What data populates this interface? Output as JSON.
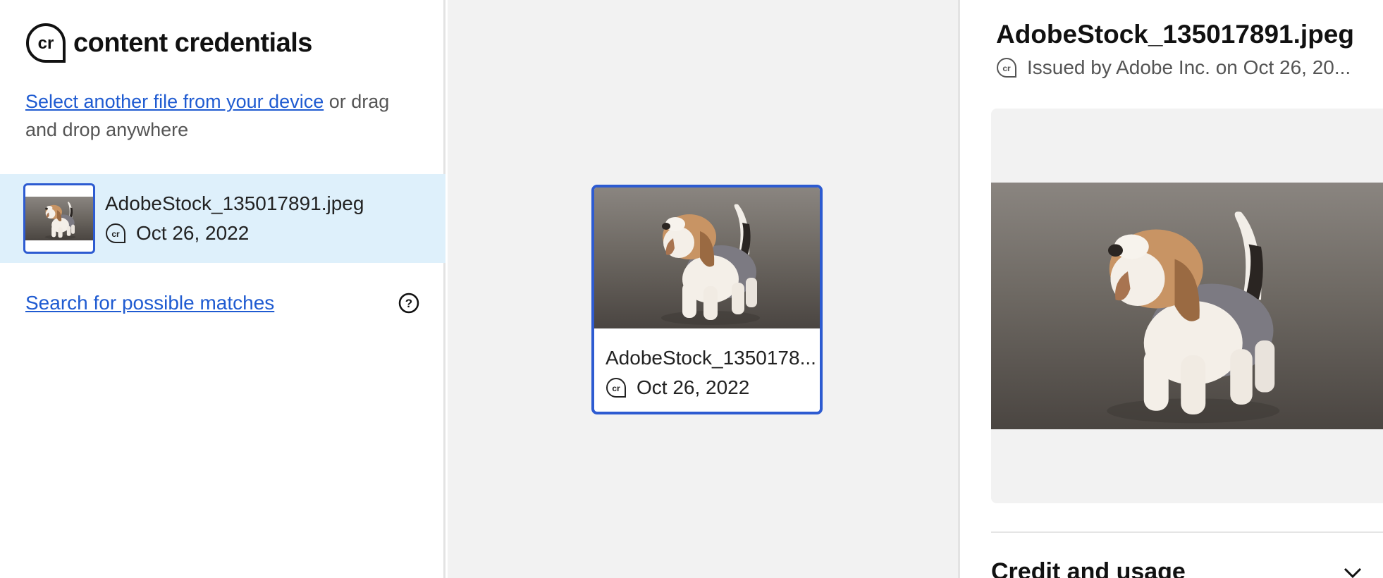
{
  "brand": {
    "logo_text": "cr",
    "name": "content credentials"
  },
  "intro": {
    "link": "Select another file from your device",
    "rest": " or drag and drop anywhere"
  },
  "file_list": [
    {
      "name": "AdobeStock_135017891.jpeg",
      "date": "Oct 26, 2022"
    }
  ],
  "search": {
    "label": "Search for possible matches",
    "help": "?"
  },
  "canvas": {
    "card": {
      "name": "AdobeStock_1350178...",
      "date": "Oct 26, 2022"
    }
  },
  "detail": {
    "title": "AdobeStock_135017891.jpeg",
    "issued": "Issued by Adobe Inc. on Oct 26, 20...",
    "section_title": "Credit and usage"
  },
  "icons": [
    "cr-logo-icon",
    "cr-badge-icon",
    "help-circle-icon",
    "chevron-down-icon"
  ],
  "colors": {
    "accent": "#2d5bd1",
    "link": "#1f5bd1",
    "selected_bg": "#def0fb",
    "canvas_bg": "#f2f2f2"
  }
}
